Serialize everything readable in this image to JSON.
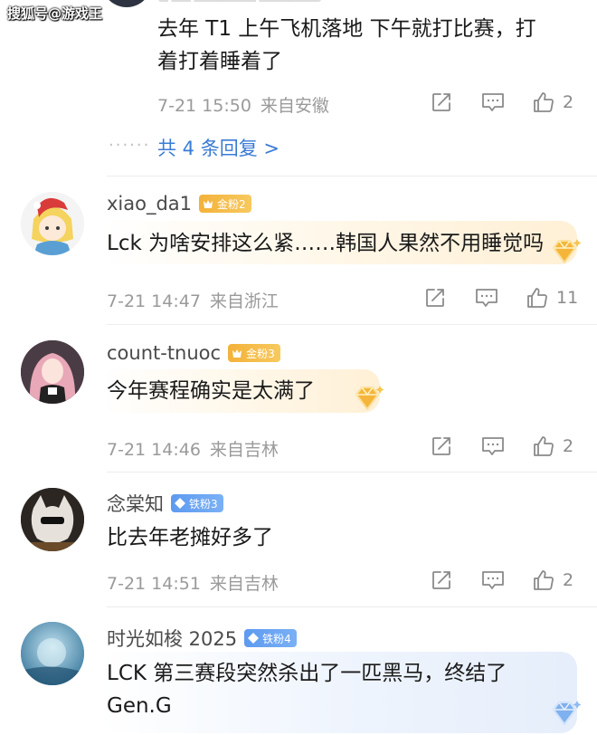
{
  "watermark": "搜狐号@游戏王",
  "top_comment": {
    "text_line1": "去年 T1 上午飞机落地 下午就打比赛，打",
    "text_line2": "着打着睡着了",
    "time": "7-21 15:50",
    "location": "来自安徽",
    "likes": "2",
    "dots": "······",
    "replies_label": "共 4 条回复 >"
  },
  "comments": [
    {
      "username": "xiao_da1",
      "badge": "金粉2",
      "text": "Lck 为啥安排这么紧……韩国人果然不用睡觉吗",
      "time": "7-21 14:47",
      "location": "来自浙江",
      "likes": "11"
    },
    {
      "username": "count-tnuoc",
      "badge": "金粉3",
      "text": "今年赛程确实是太满了",
      "time": "7-21 14:46",
      "location": "来自吉林",
      "likes": "2"
    },
    {
      "username": "念棠知",
      "badge": "铁粉3",
      "text": "比去年老摊好多了",
      "time": "7-21 14:51",
      "location": "来自吉林",
      "likes": "2"
    },
    {
      "username": "时光如梭 2025",
      "badge": "铁粉4",
      "text_line1": "LCK 第三赛段突然杀出了一匹黑马，终结了",
      "text_line2": "Gen.G"
    }
  ],
  "colors": {
    "gold_badge": "#f3b23a",
    "iron_badge": "#5d9af0",
    "link": "#3a7bd5",
    "meta": "#9a9a9a"
  },
  "icons": [
    "share-icon",
    "comment-icon",
    "like-icon",
    "diamond-bubble-icon"
  ]
}
